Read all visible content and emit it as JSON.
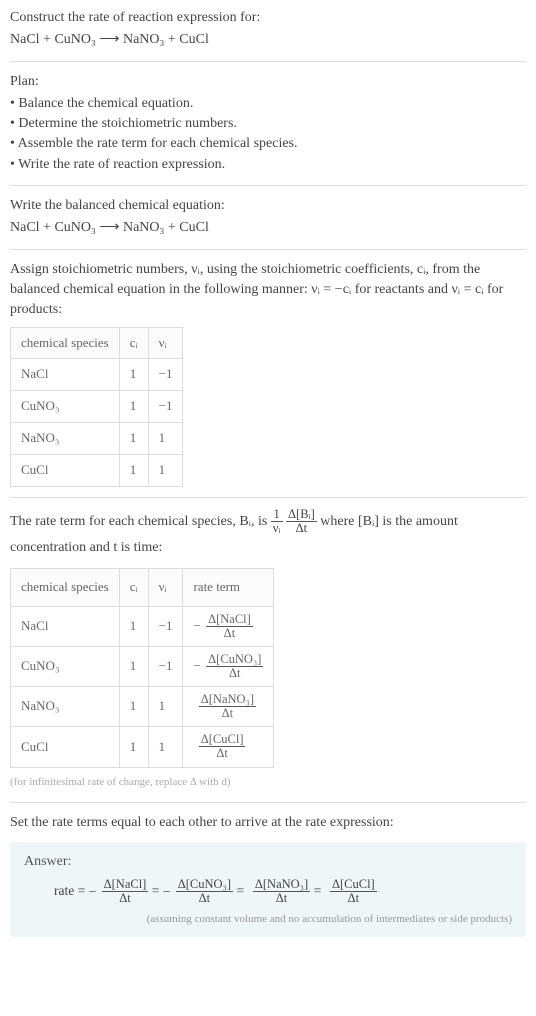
{
  "intro": {
    "line": "Construct the rate of reaction expression for:",
    "equation": "NaCl + CuNO₃ ⟶ NaNO₃ + CuCl"
  },
  "plan": {
    "title": "Plan:",
    "items": [
      "• Balance the chemical equation.",
      "• Determine the stoichiometric numbers.",
      "• Assemble the rate term for each chemical species.",
      "• Write the rate of reaction expression."
    ]
  },
  "balanced": {
    "line": "Write the balanced chemical equation:",
    "equation": "NaCl + CuNO₃ ⟶ NaNO₃ + CuCl"
  },
  "stoich": {
    "text": "Assign stoichiometric numbers, νᵢ, using the stoichiometric coefficients, cᵢ, from the balanced chemical equation in the following manner: νᵢ = −cᵢ for reactants and νᵢ = cᵢ for products:",
    "headers": [
      "chemical species",
      "cᵢ",
      "νᵢ"
    ],
    "rows": [
      {
        "species": "NaCl",
        "c": "1",
        "v": "−1"
      },
      {
        "species": "CuNO₃",
        "c": "1",
        "v": "−1"
      },
      {
        "species": "NaNO₃",
        "c": "1",
        "v": "1"
      },
      {
        "species": "CuCl",
        "c": "1",
        "v": "1"
      }
    ]
  },
  "rateterm": {
    "text_pre": "The rate term for each chemical species, Bᵢ, is ",
    "frac1_top": "1",
    "frac1_bot": "νᵢ",
    "frac2_top": "Δ[Bᵢ]",
    "frac2_bot": "Δt",
    "text_post": " where [Bᵢ] is the amount concentration and t is time:",
    "headers": [
      "chemical species",
      "cᵢ",
      "νᵢ",
      "rate term"
    ],
    "rows": [
      {
        "species": "NaCl",
        "c": "1",
        "v": "−1",
        "neg": "−",
        "top": "Δ[NaCl]",
        "bot": "Δt"
      },
      {
        "species": "CuNO₃",
        "c": "1",
        "v": "−1",
        "neg": "−",
        "top": "Δ[CuNO₃]",
        "bot": "Δt"
      },
      {
        "species": "NaNO₃",
        "c": "1",
        "v": "1",
        "neg": "",
        "top": "Δ[NaNO₃]",
        "bot": "Δt"
      },
      {
        "species": "CuCl",
        "c": "1",
        "v": "1",
        "neg": "",
        "top": "Δ[CuCl]",
        "bot": "Δt"
      }
    ],
    "caption": "(for infinitesimal rate of change, replace Δ with d)"
  },
  "final": {
    "text": "Set the rate terms equal to each other to arrive at the rate expression:"
  },
  "answer": {
    "title": "Answer:",
    "prefix": "rate = ",
    "terms": [
      {
        "neg": "−",
        "top": "Δ[NaCl]",
        "bot": "Δt"
      },
      {
        "neg": "−",
        "top": "Δ[CuNO₃]",
        "bot": "Δt"
      },
      {
        "neg": "",
        "top": "Δ[NaNO₃]",
        "bot": "Δt"
      },
      {
        "neg": "",
        "top": "Δ[CuCl]",
        "bot": "Δt"
      }
    ],
    "sep": " = ",
    "note": "(assuming constant volume and no accumulation of intermediates or side products)"
  }
}
